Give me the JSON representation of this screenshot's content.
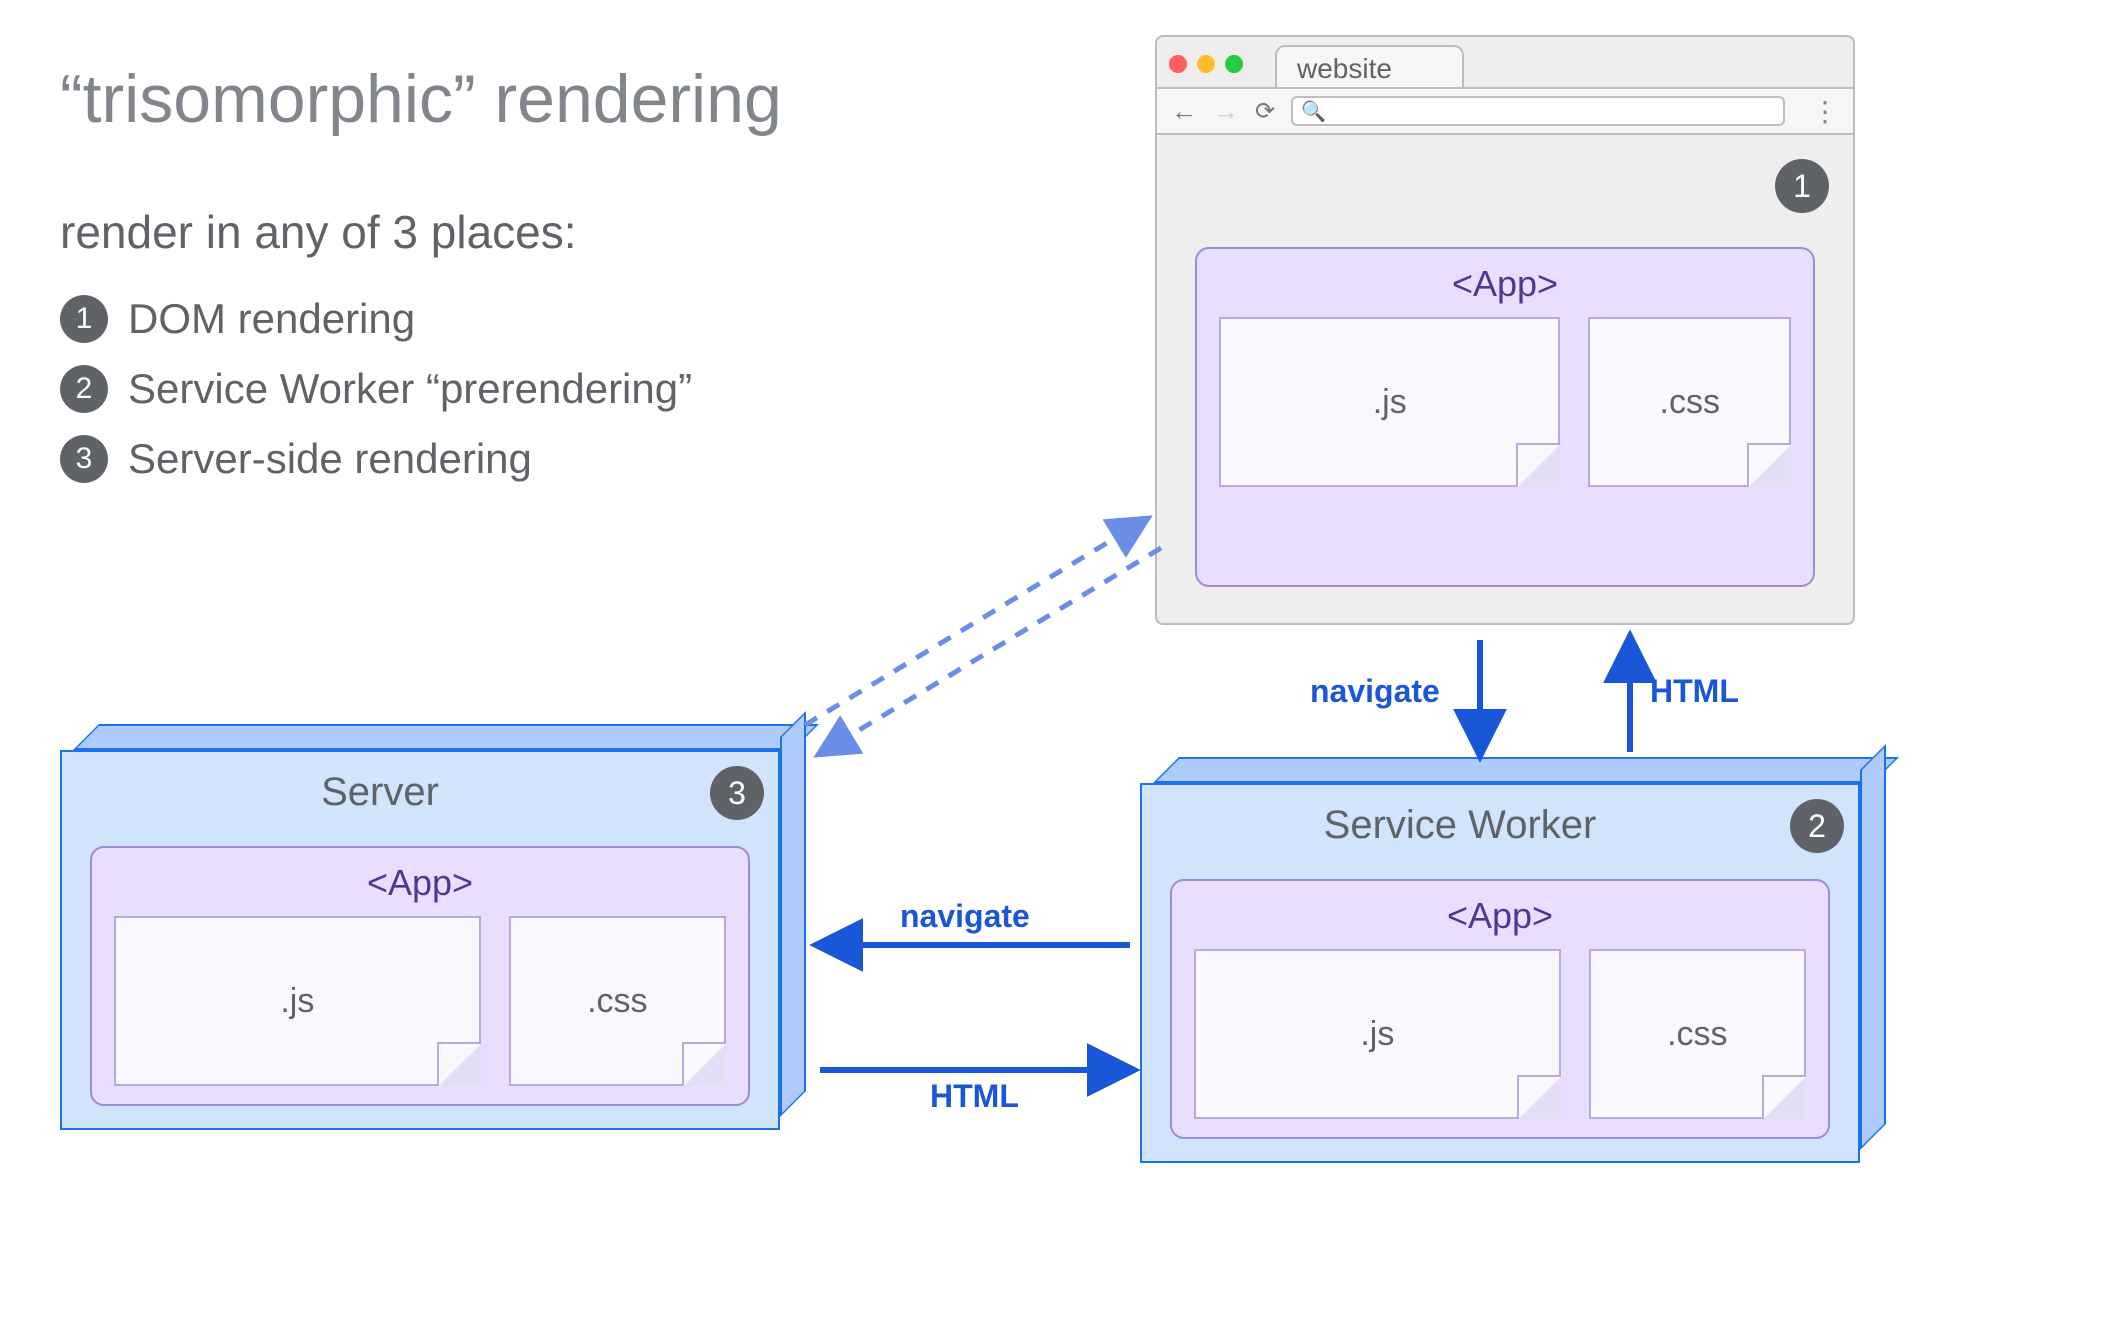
{
  "title": "“trisomorphic” rendering",
  "subtitle": "render in any of 3 places:",
  "bullets": [
    {
      "num": "1",
      "text": "DOM rendering"
    },
    {
      "num": "2",
      "text": "Service Worker “prerendering”"
    },
    {
      "num": "3",
      "text": "Server-side rendering"
    }
  ],
  "browser": {
    "tab_label": "website",
    "badge": "1",
    "url_icon": "🔍",
    "app": {
      "title": "<App>",
      "js": ".js",
      "css": ".css"
    },
    "nav_back": "←",
    "nav_fwd": "→",
    "reload": "⟳",
    "kebab": "⋮"
  },
  "server_block": {
    "title": "Server",
    "badge": "3",
    "app": {
      "title": "<App>",
      "js": ".js",
      "css": ".css"
    }
  },
  "sw_block": {
    "title": "Service Worker",
    "badge": "2",
    "app": {
      "title": "<App>",
      "js": ".js",
      "css": ".css"
    }
  },
  "arrows": {
    "browser_sw_down": "navigate",
    "browser_sw_up": "HTML",
    "sw_server_left": "navigate",
    "sw_server_right": "HTML"
  },
  "colors": {
    "block_fill": "#d2e3fc",
    "block_edge": "#1a73e8",
    "block_shade": "#aecbfa",
    "app_fill": "#e8deff",
    "app_edge": "#9c8cd4",
    "badge": "#5f6368",
    "arrow": "#1a57d6"
  }
}
